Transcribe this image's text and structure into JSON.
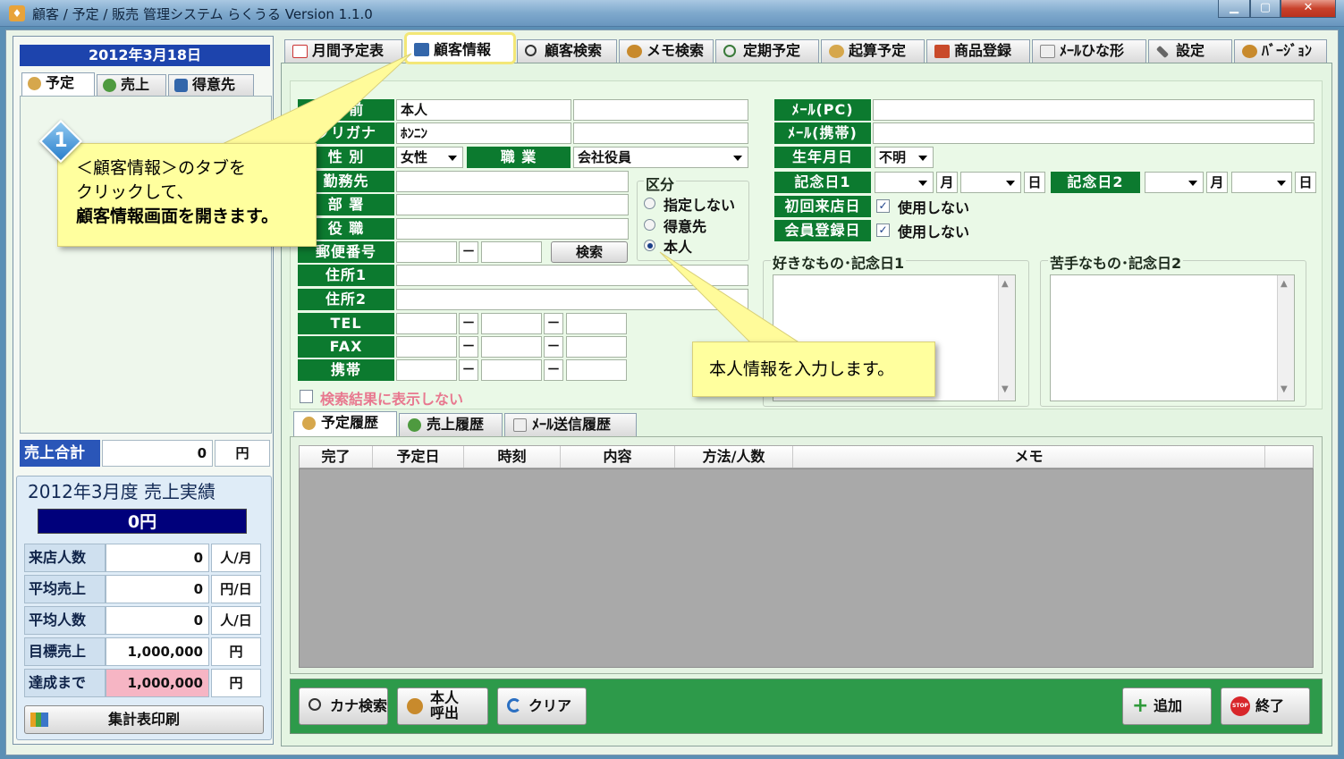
{
  "window": {
    "title": "顧客 / 予定 / 販売 管理システム らくうる  Version 1.1.0",
    "min": "▁",
    "max": "▢",
    "close": "✕"
  },
  "left": {
    "date": "2012年3月18日",
    "tabs": [
      "予定",
      "売上",
      "得意先"
    ],
    "sales_total_label": "売上合計",
    "sales_total_value": "0",
    "sales_total_unit": "円",
    "result_title": "2012年3月度  売上実績",
    "result_value": "0円",
    "stats": [
      {
        "label": "来店人数",
        "value": "0",
        "unit": "人/月"
      },
      {
        "label": "平均売上",
        "value": "0",
        "unit": "円/日"
      },
      {
        "label": "平均人数",
        "value": "0",
        "unit": "人/日"
      },
      {
        "label": "目標売上",
        "value": "1,000,000",
        "unit": "円"
      },
      {
        "label": "達成まで",
        "value": "1,000,000",
        "unit": "円"
      }
    ],
    "print_button": "集計表印刷"
  },
  "top_tabs": [
    "月間予定表",
    "顧客情報",
    "顧客検索",
    "メモ検索",
    "定期予定",
    "起算予定",
    "商品登録",
    "ﾒｰﾙひな形",
    "設定",
    "ﾊﾞｰｼﾞｮﾝ"
  ],
  "form": {
    "name_label": "名 前",
    "name_value": "本人",
    "kana_label": "フリガナ",
    "kana_value": "ﾎﾝﾆﾝ",
    "gender_label": "性 別",
    "gender_value": "女性",
    "job_label": "職 業",
    "job_value": "会社役員",
    "company_label": "勤務先",
    "dept_label": "部 署",
    "position_label": "役 職",
    "zip_label": "郵便番号",
    "zip_dash": "－",
    "search_button": "検索",
    "addr1_label": "住所1",
    "addr2_label": "住所2",
    "tel_label": "TEL",
    "fax_label": "FAX",
    "mobile_label": "携帯",
    "hide_label": "検索結果に表示しない",
    "category_title": "区分",
    "category_options": [
      "指定しない",
      "得意先",
      "本人"
    ],
    "mail_pc_label": "ﾒｰﾙ(PC)",
    "mail_mobile_label": "ﾒｰﾙ(携帯)",
    "birthday_label": "生年月日",
    "birthday_value": "不明",
    "anniv1_label": "記念日1",
    "anniv2_label": "記念日2",
    "month_unit": "月",
    "day_unit": "日",
    "first_visit_label": "初回来店日",
    "first_visit_check": "使用しない",
    "member_label": "会員登録日",
    "member_check": "使用しない",
    "likes_label": "好きなもの･記念日1",
    "dislikes_label": "苦手なもの･記念日2"
  },
  "history_tabs": [
    "予定履歴",
    "売上履歴",
    "ﾒｰﾙ送信履歴"
  ],
  "grid_columns": [
    "完了",
    "予定日",
    "時刻",
    "内容",
    "方法/人数",
    "メモ"
  ],
  "buttons": {
    "kana_search": "カナ検索",
    "call_self_1": "本人",
    "call_self_2": "呼出",
    "clear": "クリア",
    "add": "追加",
    "exit": "終了",
    "stop": "STOP"
  },
  "callout1": {
    "number": "1",
    "line1": "＜顧客情報＞のタブを",
    "line2": "クリックして、",
    "line3": "顧客情報画面を開きます。"
  },
  "callout2": {
    "text": "本人情報を入力します。"
  }
}
